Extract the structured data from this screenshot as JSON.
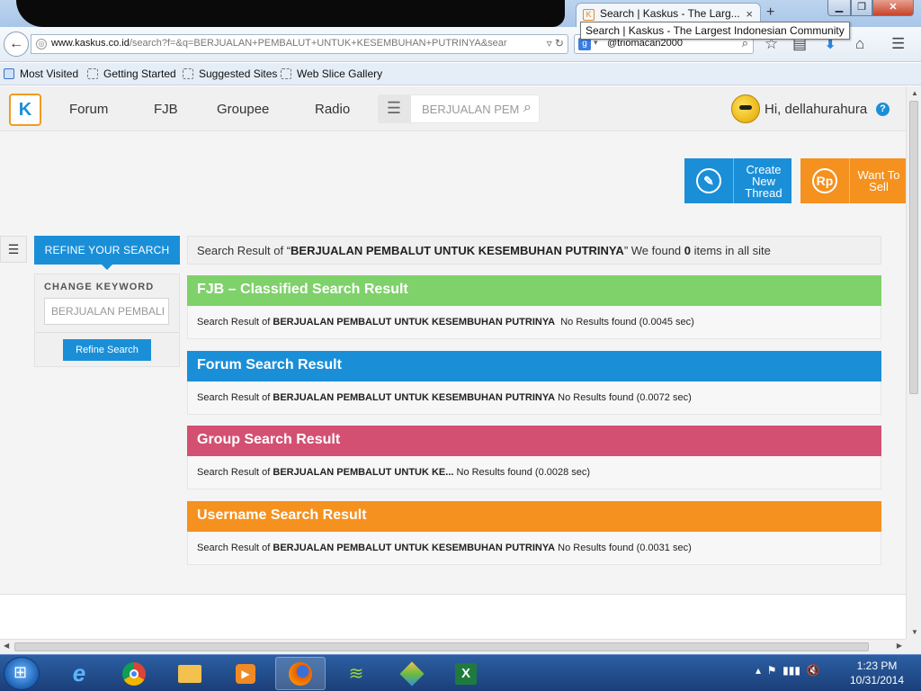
{
  "browser": {
    "tab_title": "Search | Kaskus - The Larg...",
    "tab_close": "×",
    "new_tab": "+",
    "tooltip": "Search | Kaskus - The Largest Indonesian Community",
    "url_domain": "www.kaskus.co.id",
    "url_rest": "/search?f=&q=BERJUALAN+PEMBALUT+UNTUK+KESEMBUHAN+PUTRINYA&sear",
    "search_engine_text": "@triomacan2000",
    "bookmarks": [
      "Most Visited",
      "Getting Started",
      "Suggested Sites",
      "Web Slice Gallery"
    ]
  },
  "site": {
    "logo": "K",
    "nav": [
      "Forum",
      "FJB",
      "Groupee",
      "Radio"
    ],
    "search_value": "BERJUALAN PEM",
    "greeting": "Hi, dellahurahura",
    "help": "?"
  },
  "actions": {
    "create_label": "Create New Thread",
    "sell_label": "Want To Sell",
    "sell_icon_text": "Rp"
  },
  "refine": {
    "tab_label": "REFINE YOUR SEARCH",
    "change_keyword_label": "CHANGE KEYWORD",
    "keyword_value": "BERJUALAN PEMBALI",
    "button_label": "Refine Search"
  },
  "summary": {
    "prefix": "Search Result of “",
    "query": "BERJUALAN PEMBALUT UNTUK KESEMBUHAN PUTRINYA",
    "middle": "” We found ",
    "count": "0",
    "suffix": " items in all site"
  },
  "sections": {
    "fjb": {
      "title": "FJB – Classified Search Result",
      "prefix": "Search Result of ",
      "query": "BERJUALAN PEMBALUT UNTUK KESEMBUHAN PUTRINYA",
      "status": "  No Results found (0.0045 sec)"
    },
    "forum": {
      "title": "Forum Search Result",
      "prefix": "Search Result of ",
      "query": "BERJUALAN PEMBALUT UNTUK KESEMBUHAN PUTRINYA",
      "status": " No Results found (0.0072 sec)"
    },
    "group": {
      "title": "Group Search Result",
      "prefix": "Search Result of ",
      "query": "BERJUALAN PEMBALUT UNTUK KE...",
      "status": " No Results found (0.0028 sec)"
    },
    "user": {
      "title": "Username Search Result",
      "prefix": "Search Result of ",
      "query": "BERJUALAN PEMBALUT UNTUK KESEMBUHAN PUTRINYA",
      "status": " No Results found (0.0031 sec)"
    }
  },
  "taskbar": {
    "time": "1:23 PM",
    "date": "10/31/2014"
  },
  "colors": {
    "kaskus_blue": "#1a8fd8",
    "kaskus_orange": "#f5911e",
    "fjb_green": "#7fd16a",
    "group_pink": "#d35072"
  }
}
